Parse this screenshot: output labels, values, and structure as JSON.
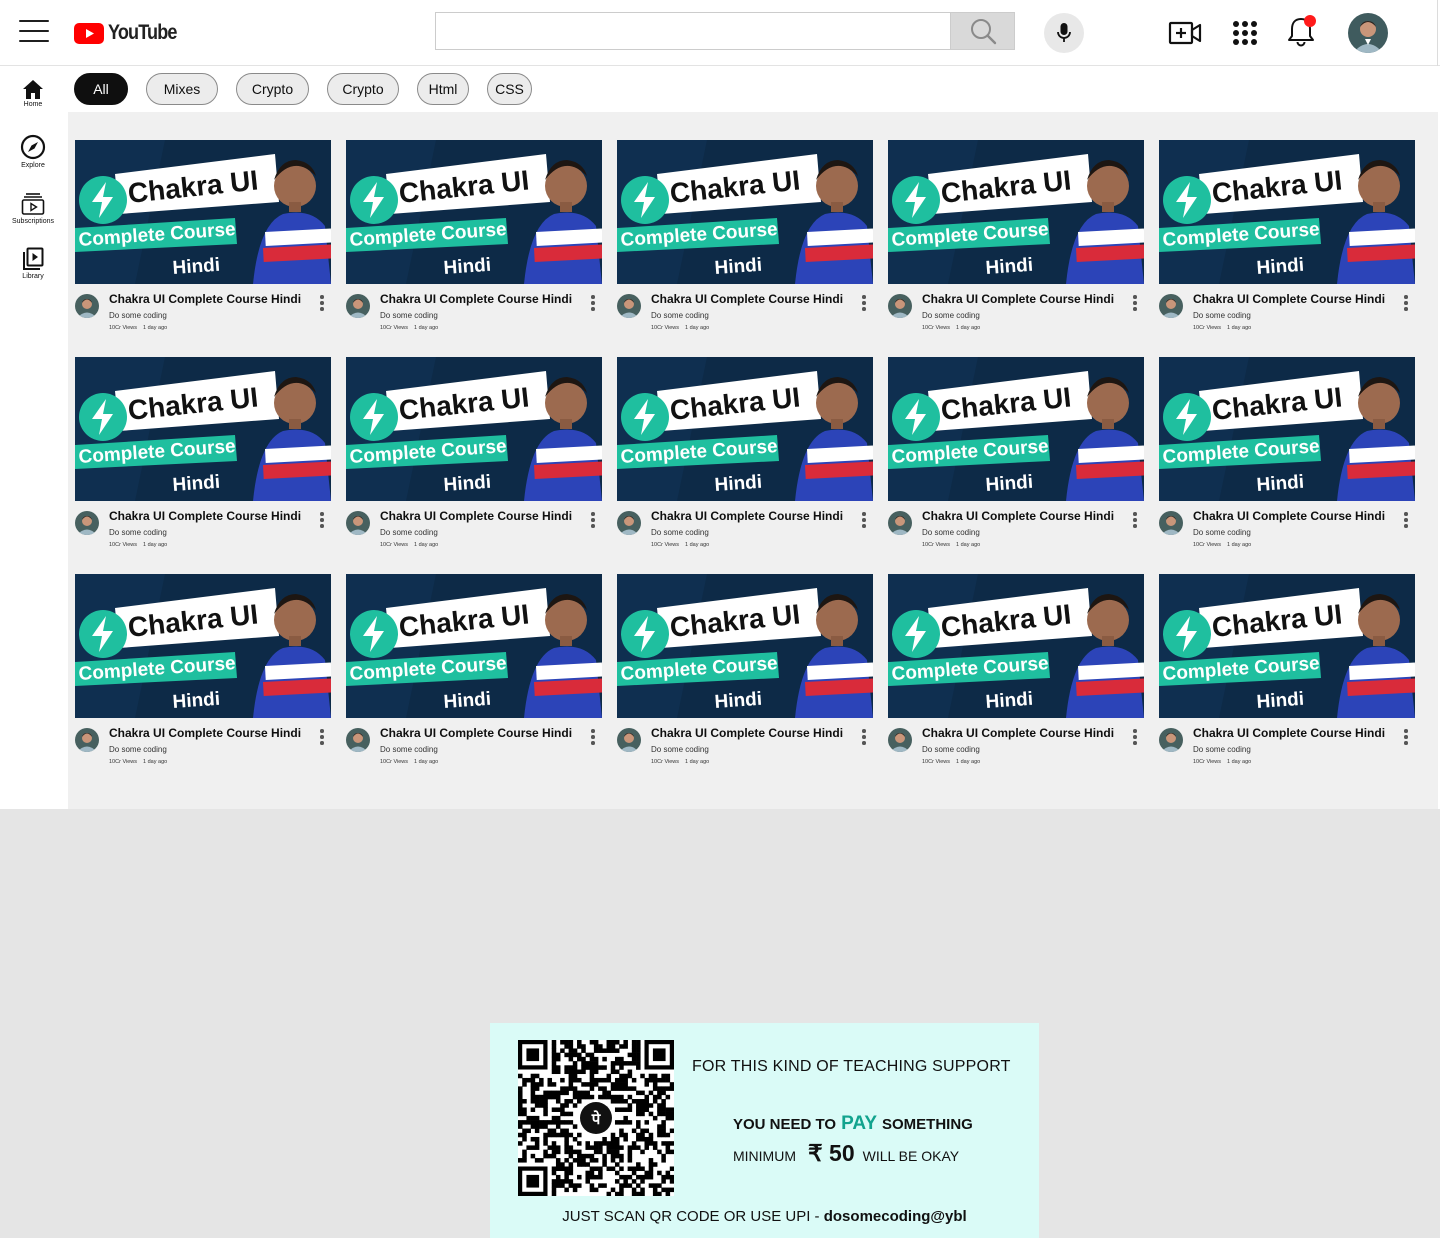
{
  "header": {
    "logo_text": "YouTube",
    "search_placeholder": "",
    "icons": [
      "menu-icon",
      "youtube-logo-icon",
      "search-icon",
      "mic-icon",
      "create-video-icon",
      "apps-grid-icon",
      "notifications-bell-icon",
      "account-avatar"
    ]
  },
  "sidebar": {
    "items": [
      {
        "label": "Home",
        "icon": "home-icon"
      },
      {
        "label": "Explore",
        "icon": "compass-icon"
      },
      {
        "label": "Subscriptions",
        "icon": "subscriptions-icon"
      },
      {
        "label": "Library",
        "icon": "library-icon"
      }
    ]
  },
  "chips": [
    "All",
    "Mixes",
    "Crypto",
    "Crypto",
    "Html",
    "CSS"
  ],
  "active_chip": "All",
  "thumbnail": {
    "line1": "Chakra UI",
    "line2": "Complete Course",
    "line3": "Hindi"
  },
  "videos": [
    {
      "title": "Chakra UI Complete Course Hindi",
      "channel": "Do some coding",
      "views": "10Cr Views",
      "age": "1 day ago"
    },
    {
      "title": "Chakra UI Complete Course Hindi",
      "channel": "Do some coding",
      "views": "10Cr Views",
      "age": "1 day ago"
    },
    {
      "title": "Chakra UI Complete Course Hindi",
      "channel": "Do some coding",
      "views": "10Cr Views",
      "age": "1 day ago"
    },
    {
      "title": "Chakra UI Complete Course Hindi",
      "channel": "Do some coding",
      "views": "10Cr Views",
      "age": "1 day ago"
    },
    {
      "title": "Chakra UI Complete Course Hindi",
      "channel": "Do some coding",
      "views": "10Cr Views",
      "age": "1 day ago"
    },
    {
      "title": "Chakra UI Complete Course Hindi",
      "channel": "Do some coding",
      "views": "10Cr Views",
      "age": "1 day ago"
    },
    {
      "title": "Chakra UI Complete Course Hindi",
      "channel": "Do some coding",
      "views": "10Cr Views",
      "age": "1 day ago"
    },
    {
      "title": "Chakra UI Complete Course Hindi",
      "channel": "Do some coding",
      "views": "10Cr Views",
      "age": "1 day ago"
    },
    {
      "title": "Chakra UI Complete Course Hindi",
      "channel": "Do some coding",
      "views": "10Cr Views",
      "age": "1 day ago"
    },
    {
      "title": "Chakra UI Complete Course Hindi",
      "channel": "Do some coding",
      "views": "10Cr Views",
      "age": "1 day ago"
    },
    {
      "title": "Chakra UI Complete Course Hindi",
      "channel": "Do some coding",
      "views": "10Cr Views",
      "age": "1 day ago"
    },
    {
      "title": "Chakra UI Complete Course Hindi",
      "channel": "Do some coding",
      "views": "10Cr Views",
      "age": "1 day ago"
    },
    {
      "title": "Chakra UI Complete Course Hindi",
      "channel": "Do some coding",
      "views": "10Cr Views",
      "age": "1 day ago"
    },
    {
      "title": "Chakra UI Complete Course Hindi",
      "channel": "Do some coding",
      "views": "10Cr Views",
      "age": "1 day ago"
    },
    {
      "title": "Chakra UI Complete Course Hindi",
      "channel": "Do some coding",
      "views": "10Cr Views",
      "age": "1 day ago"
    }
  ],
  "donate": {
    "line1": "FOR THIS KIND OF TEACHING SUPPORT",
    "line2_pre": "YOU NEED TO",
    "line2_pay": "PAY",
    "line2_post": "SOMETHING",
    "line3_pre": "MINIMUM",
    "line3_amount": "₹ 50",
    "line3_post": "WILL BE OKAY",
    "line4_pre": "JUST SCAN QR CODE OR USE UPI - ",
    "line4_upi": "dosomecoding@ybl",
    "qr_center_glyph": "पे"
  },
  "colors": {
    "brand_red": "#ff0000",
    "notification_dot": "#ff1a1a",
    "thumb_bg": "#0d2a47",
    "thumb_accent": "#1fbf9f",
    "pay_green": "#12a38e",
    "donate_bg": "#dafbf7"
  }
}
